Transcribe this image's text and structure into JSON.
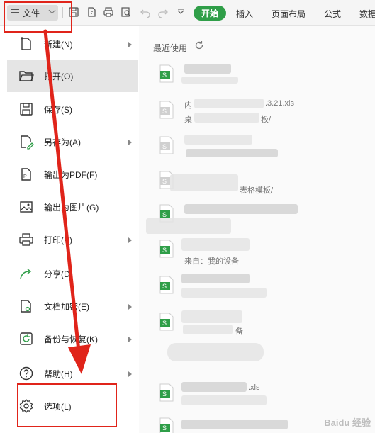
{
  "toolbar": {
    "file_label": "文件",
    "start_label": "开始",
    "tabs": [
      "插入",
      "页面布局",
      "公式",
      "数据"
    ]
  },
  "menu": {
    "items": [
      {
        "label": "新建(N)",
        "icon": "new-file-icon",
        "arrow": true
      },
      {
        "label": "打开(O)",
        "icon": "folder-open-icon",
        "arrow": false,
        "active": true
      },
      {
        "label": "保存(S)",
        "icon": "save-icon",
        "arrow": false
      },
      {
        "label": "另存为(A)",
        "icon": "save-as-icon",
        "arrow": true
      },
      {
        "label": "输出为PDF(F)",
        "icon": "pdf-export-icon",
        "arrow": false
      },
      {
        "label": "输出为图片(G)",
        "icon": "image-export-icon",
        "arrow": false
      },
      {
        "label": "打印(P)",
        "icon": "printer-icon",
        "arrow": true
      },
      {
        "label": "分享(D)",
        "icon": "share-icon",
        "arrow": false
      },
      {
        "label": "文档加密(E)",
        "icon": "doc-encrypt-icon",
        "arrow": true
      },
      {
        "label": "备份与恢复(K)",
        "icon": "backup-icon",
        "arrow": true
      },
      {
        "label": "帮助(H)",
        "icon": "help-icon",
        "arrow": true
      },
      {
        "label": "选项(L)",
        "icon": "settings-icon",
        "arrow": false
      }
    ]
  },
  "recent": {
    "header": "最近使用",
    "texts": {
      "t1": "内",
      "t2": ".3.21.xls",
      "t3": "桌",
      "t4": "板/",
      "t5": "表格模板/",
      "t6": "来自：我的设备",
      "t7": "备",
      "t8": ".xls"
    }
  },
  "watermark": "Baidu 经验",
  "colors": {
    "accent_green": "#2f9e48",
    "annotation_red": "#e0241a"
  }
}
